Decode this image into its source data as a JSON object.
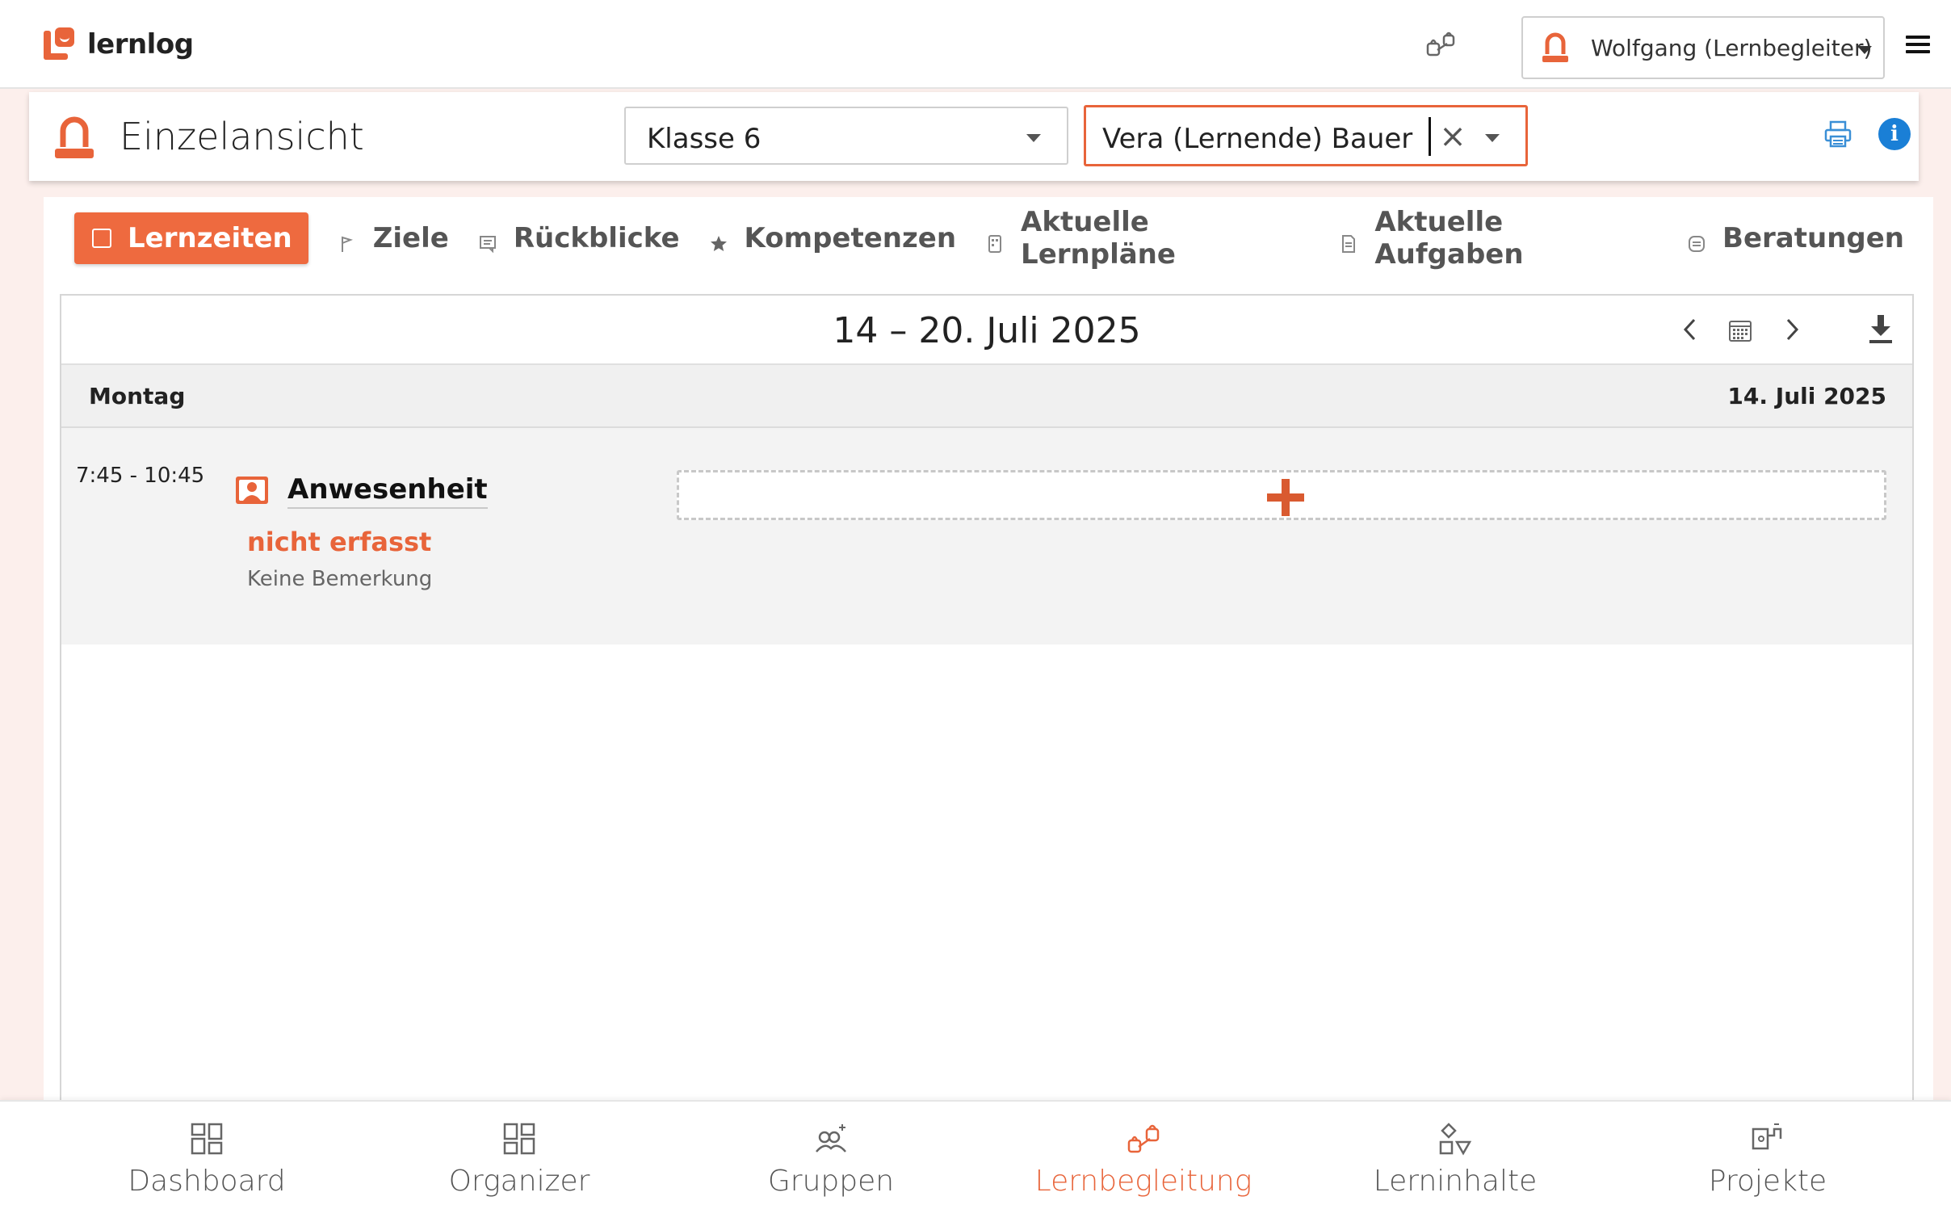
{
  "app": {
    "name": "lernlog"
  },
  "header": {
    "user_label": "Wolfgang (Lernbegleiter)"
  },
  "einzelansicht": {
    "title": "Einzelansicht",
    "class_select": {
      "value": "Klasse 6"
    },
    "student_select": {
      "value": "Vera (Lernende) Bauer"
    }
  },
  "tabs": [
    {
      "label": "Lernzeiten",
      "icon": "calendar-grid-icon",
      "active": true
    },
    {
      "label": "Ziele",
      "icon": "flag-icon"
    },
    {
      "label": "Rückblicke",
      "icon": "comment-icon"
    },
    {
      "label": "Kompetenzen",
      "icon": "star-icon"
    },
    {
      "label": "Aktuelle Lernpläne",
      "icon": "plan-icon"
    },
    {
      "label": "Aktuelle Aufgaben",
      "icon": "document-icon"
    },
    {
      "label": "Beratungen",
      "icon": "chat-icon"
    }
  ],
  "week": {
    "title": "14 – 20. Juli 2025"
  },
  "day": {
    "name": "Montag",
    "date": "14. Juli 2025",
    "entry": {
      "time": "7:45 - 10:45",
      "title": "Anwesenheit",
      "status": "nicht erfasst",
      "note": "Keine Bemerkung"
    }
  },
  "bottom_nav": [
    {
      "label": "Dashboard",
      "icon": "dashboard-icon"
    },
    {
      "label": "Organizer",
      "icon": "organizer-icon"
    },
    {
      "label": "Gruppen",
      "icon": "groups-icon"
    },
    {
      "label": "Lernbegleitung",
      "icon": "learning-support-icon",
      "active": true
    },
    {
      "label": "Lerninhalte",
      "icon": "shapes-icon"
    },
    {
      "label": "Projekte",
      "icon": "puzzle-icon"
    }
  ],
  "colors": {
    "accent": "#e8643a",
    "info": "#1a7fd6",
    "print": "#3a8fd6",
    "page_bg": "#fcefec"
  }
}
